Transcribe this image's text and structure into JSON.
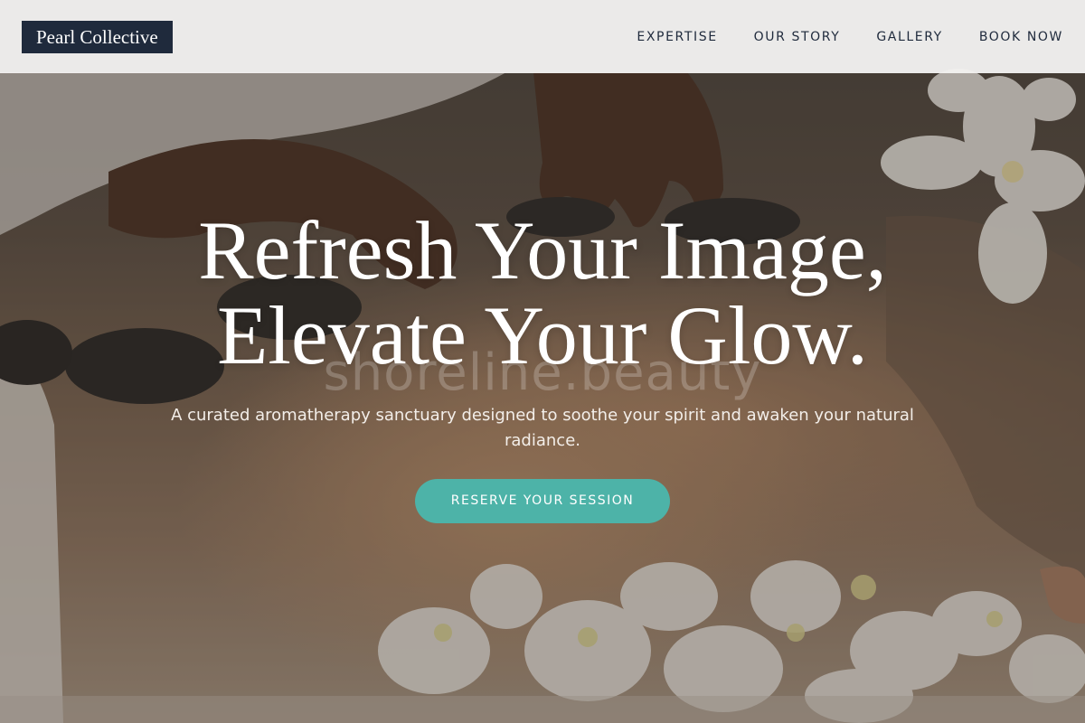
{
  "header": {
    "logo": "Pearl Collective",
    "nav": [
      {
        "label": "EXPERTISE"
      },
      {
        "label": "OUR STORY"
      },
      {
        "label": "GALLERY"
      },
      {
        "label": "BOOK NOW"
      }
    ]
  },
  "hero": {
    "headline_line1": "Refresh Your Image,",
    "headline_line2": "Elevate Your Glow.",
    "subtext": "A curated aromatherapy sanctuary designed to soothe your spirit and awaken your natural radiance.",
    "cta_label": "RESERVE YOUR SESSION",
    "watermark": "shoreline.beauty"
  },
  "colors": {
    "logo_bg": "#1f2a3c",
    "nav_text": "#1f2a3c",
    "cta_bg": "#4db3a8"
  }
}
